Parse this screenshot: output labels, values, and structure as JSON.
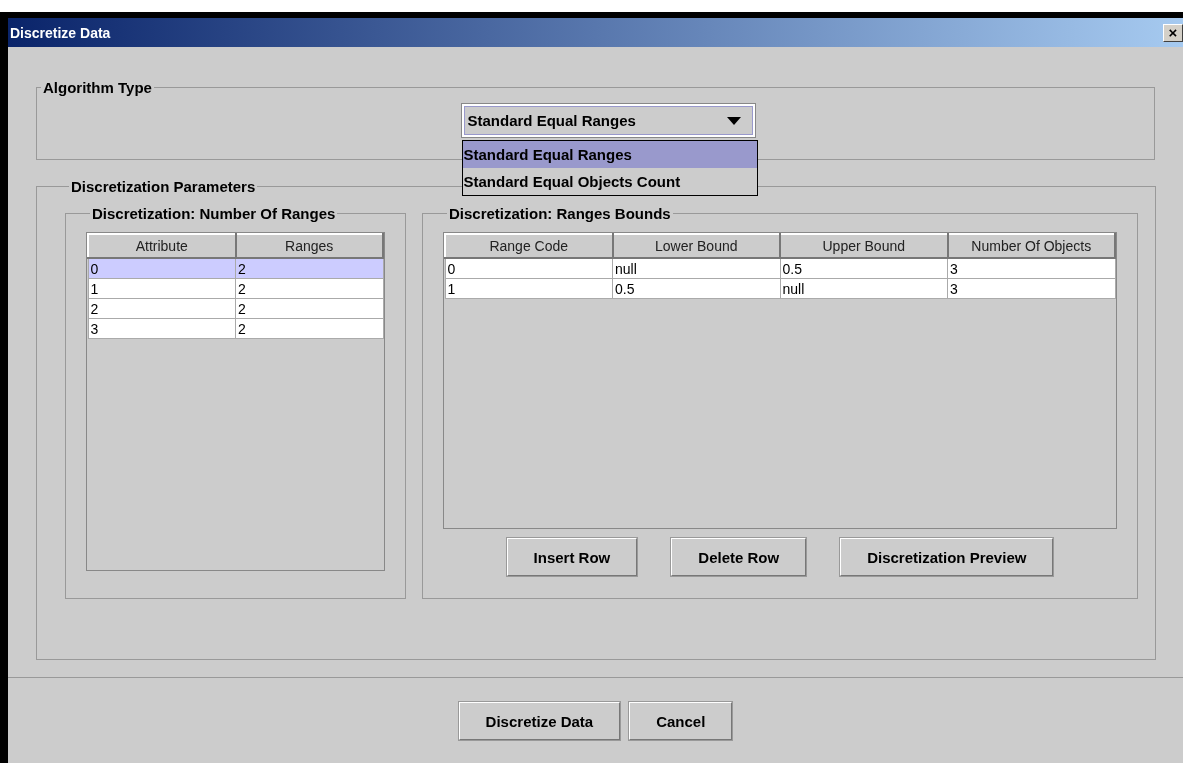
{
  "window": {
    "title": "Discretize Data",
    "close": "×"
  },
  "algorithm_type": {
    "legend": "Algorithm Type",
    "combo": {
      "value": "Standard Equal Ranges",
      "expanded": true
    },
    "options": [
      {
        "label": "Standard Equal Ranges",
        "selected": true
      },
      {
        "label": "Standard Equal Objects Count",
        "selected": false
      }
    ]
  },
  "parameters": {
    "legend": "Discretization Parameters",
    "ranges_panel": {
      "legend": "Discretization: Number Of Ranges",
      "columns": [
        "Attribute",
        "Ranges"
      ],
      "rows": [
        {
          "cells": [
            "0",
            "2"
          ],
          "selected": true
        },
        {
          "cells": [
            "1",
            "2"
          ],
          "selected": false
        },
        {
          "cells": [
            "2",
            "2"
          ],
          "selected": false
        },
        {
          "cells": [
            "3",
            "2"
          ],
          "selected": false
        }
      ]
    },
    "bounds_panel": {
      "legend": "Discretization: Ranges Bounds",
      "columns": [
        "Range Code",
        "Lower Bound",
        "Upper Bound",
        "Number Of Objects"
      ],
      "rows": [
        {
          "cells": [
            "0",
            "null",
            "0.5",
            "3"
          ],
          "selected": false
        },
        {
          "cells": [
            "1",
            "0.5",
            "null",
            "3"
          ],
          "selected": false
        }
      ],
      "buttons": [
        "Insert Row",
        "Delete Row",
        "Discretization Preview"
      ]
    }
  },
  "buttons": [
    "Discretize Data",
    "Cancel"
  ]
}
